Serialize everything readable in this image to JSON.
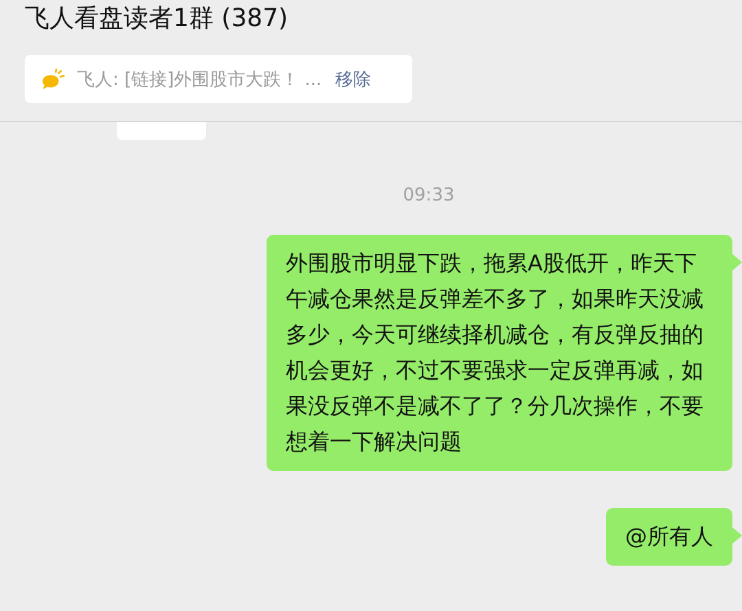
{
  "header": {
    "title": "飞人看盘读者1群 (387)"
  },
  "pinned": {
    "text": "飞人: [链接]外围股市大跌！ ...",
    "action": "移除"
  },
  "messages": [
    {
      "kind": "incoming-cut"
    },
    {
      "kind": "time",
      "text": "09:33"
    },
    {
      "kind": "outgoing",
      "text": "外围股市明显下跌，拖累A股低开，昨天下午减仓果然是反弹差不多了，如果昨天没减多少，今天可继续择机减仓，有反弹反抽的机会更好，不过不要强求一定反弹再减，如果没反弹不是减不了了？分几次操作，不要想着一下解决问题"
    },
    {
      "kind": "outgoing",
      "text": "@所有人"
    }
  ]
}
